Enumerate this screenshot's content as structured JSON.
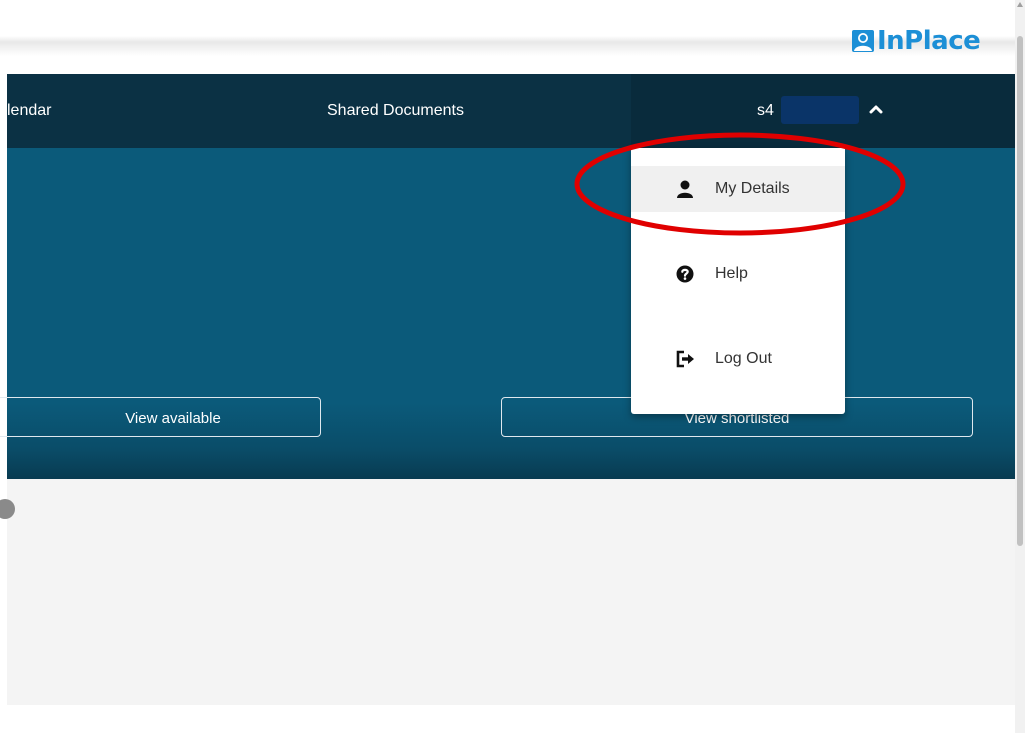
{
  "brand": {
    "name": "InPlace",
    "color": "#1c8fd6"
  },
  "nav": {
    "items": [
      {
        "label": "lendar"
      },
      {
        "label": "Shared Documents"
      }
    ],
    "user": {
      "label": "s4",
      "redacted": true
    }
  },
  "hero": {
    "buttons": {
      "available": "View available",
      "shortlisted": "View shortlisted"
    }
  },
  "user_menu": {
    "open": true,
    "items": [
      {
        "label": "My Details",
        "icon": "user-icon",
        "active": true
      },
      {
        "label": "Help",
        "icon": "question-circle-icon"
      },
      {
        "label": "Log Out",
        "icon": "sign-out-icon"
      }
    ]
  },
  "annotation": {
    "shape": "ellipse",
    "color": "#e00000",
    "target": "My Details"
  },
  "colors": {
    "nav_background": "#0b3144",
    "hero_background": "#0b5a7a",
    "content_background": "#f4f4f4"
  }
}
